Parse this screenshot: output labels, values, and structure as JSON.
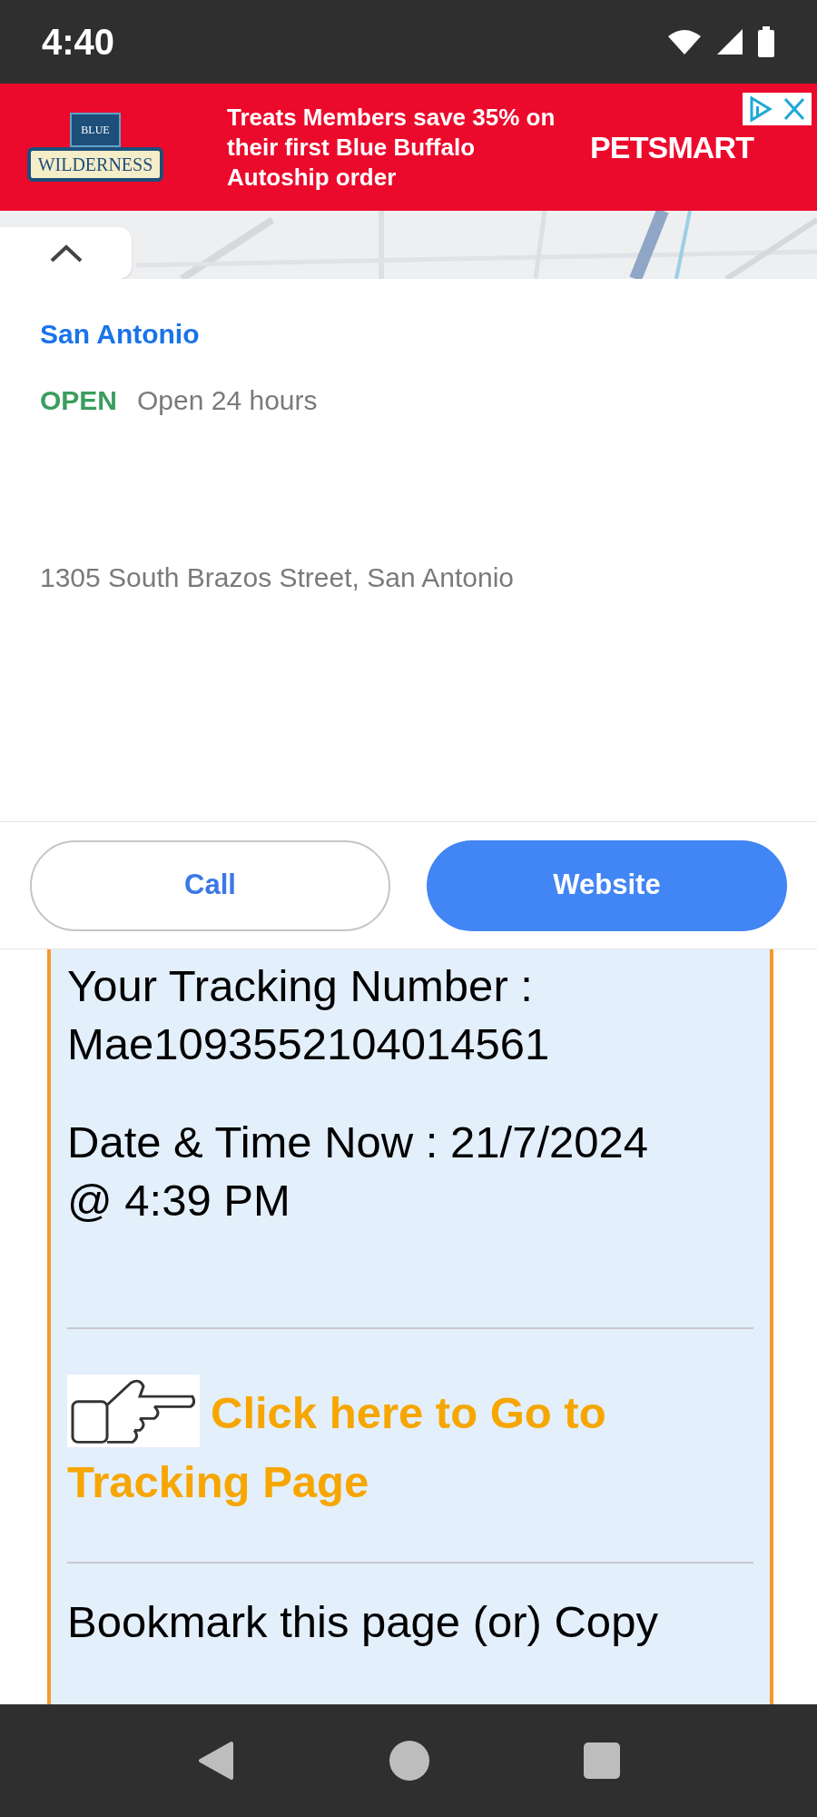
{
  "status_bar": {
    "time": "4:40"
  },
  "ad": {
    "logo_top": "BLUE",
    "logo": "WILDERNESS",
    "text": "Treats Members save 35% on their first Blue Buffalo Autoship order",
    "brand": "PETSMART"
  },
  "place": {
    "name": "San Antonio",
    "status": "OPEN",
    "is_open": true,
    "hours": "Open 24 hours",
    "address": "1305 South Brazos Street, San Antonio"
  },
  "actions": [
    {
      "label": "Call",
      "kind": "outline"
    },
    {
      "label": "Website",
      "kind": "filled"
    }
  ],
  "tracking": {
    "number_label": "Your Tracking Number :",
    "number": "Mae1093552104014561",
    "datetime": "Date & Time Now : 21/7/2024 @ 4:39 PM",
    "link": "Click here to Go to Tracking Page",
    "note": "Bookmark this page (or) Copy"
  }
}
